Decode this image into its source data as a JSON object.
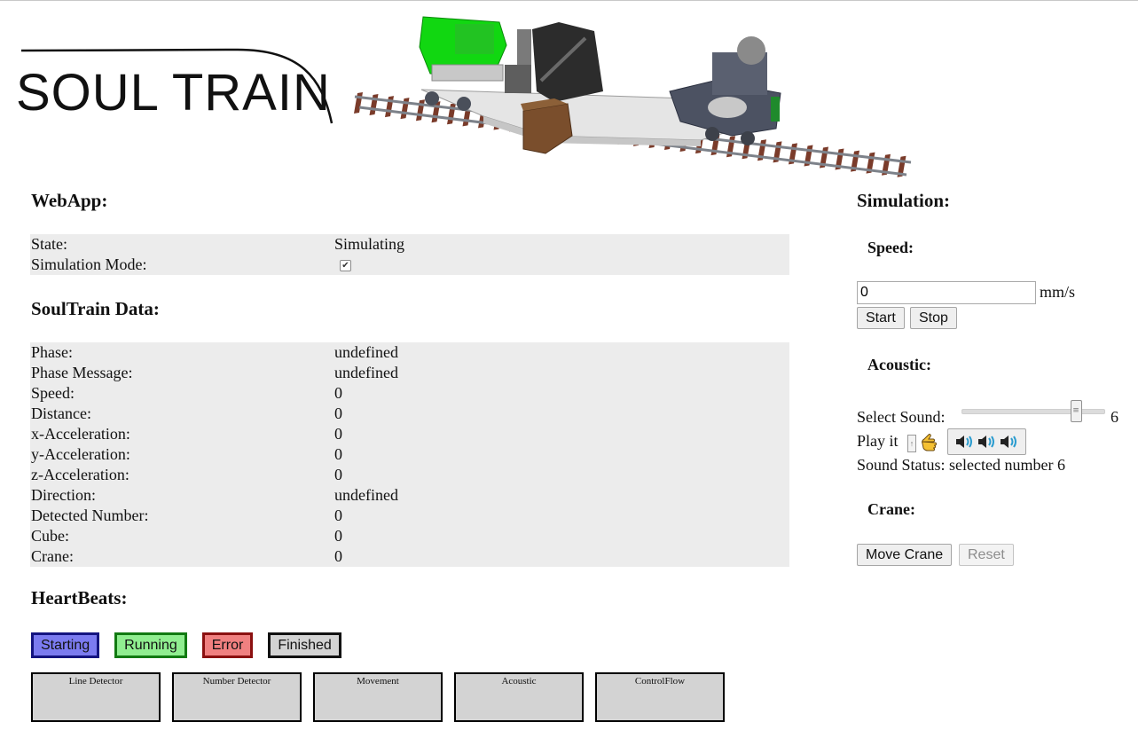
{
  "brand": {
    "logo_text": "SOUL TRAIN"
  },
  "webapp": {
    "title": "WebApp:",
    "rows": [
      {
        "label": "State:",
        "value": "Simulating"
      },
      {
        "label": "Simulation Mode:",
        "value": "",
        "checked": true
      }
    ]
  },
  "soultrain": {
    "title": "SoulTrain Data:",
    "rows": [
      {
        "label": "Phase:",
        "value": "undefined"
      },
      {
        "label": "Phase Message:",
        "value": "undefined"
      },
      {
        "label": "Speed:",
        "value": "0"
      },
      {
        "label": "Distance:",
        "value": "0"
      },
      {
        "label": "x-Acceleration:",
        "value": "0"
      },
      {
        "label": "y-Acceleration:",
        "value": "0"
      },
      {
        "label": "z-Acceleration:",
        "value": "0"
      },
      {
        "label": "Direction:",
        "value": "undefined"
      },
      {
        "label": "Detected Number:",
        "value": "0"
      },
      {
        "label": "Cube:",
        "value": "0"
      },
      {
        "label": "Crane:",
        "value": "0"
      }
    ]
  },
  "heartbeats": {
    "title": "HeartBeats:",
    "legend": [
      {
        "label": "Starting",
        "bg": "#7b7bf0",
        "border": "#141480"
      },
      {
        "label": "Running",
        "bg": "#90ee90",
        "border": "#117a11"
      },
      {
        "label": "Error",
        "bg": "#f08080",
        "border": "#8b1010"
      },
      {
        "label": "Finished",
        "bg": "#d3d3d3",
        "border": "#111111"
      }
    ],
    "boxes": [
      "Line Detector",
      "Number Detector",
      "Movement",
      "Acoustic",
      "ControlFlow"
    ]
  },
  "simulation": {
    "title": "Simulation:",
    "speed": {
      "title": "Speed:",
      "value": "0",
      "unit": "mm/s",
      "start_label": "Start",
      "stop_label": "Stop"
    },
    "acoustic": {
      "title": "Acoustic:",
      "select_label": "Select Sound:",
      "slider_value": "6",
      "slider_min": 1,
      "slider_max": 7,
      "play_label": "Play it",
      "status_label": "Sound Status: selected number 6",
      "speaker_icons": [
        "speaker-icon",
        "speaker-icon",
        "speaker-icon"
      ]
    },
    "crane": {
      "title": "Crane:",
      "move_label": "Move Crane",
      "reset_label": "Reset"
    }
  }
}
